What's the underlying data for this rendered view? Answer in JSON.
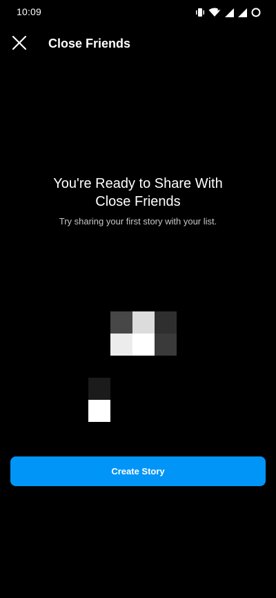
{
  "status_bar": {
    "time": "10:09",
    "icons": [
      "vibrate-icon",
      "wifi-icon",
      "signal-icon",
      "signal-icon",
      "battery-circle-icon"
    ]
  },
  "header": {
    "title": "Close Friends",
    "close_icon": "close-icon"
  },
  "message": {
    "title": "You're Ready to Share With Close Friends",
    "subtitle": "Try sharing your first story with your list."
  },
  "illustration": {
    "pixels": [
      "#474747",
      "#dcdcdc",
      "#2f2f2f",
      "#ececec",
      "#ffffff",
      "#3a3a3a",
      "#1b1b1b",
      "#ffffff"
    ]
  },
  "actions": {
    "create_story_label": "Create Story"
  },
  "colors": {
    "background": "#000000",
    "accent": "#0095f6",
    "text": "#ffffff",
    "muted_text": "#c7c7c7"
  }
}
